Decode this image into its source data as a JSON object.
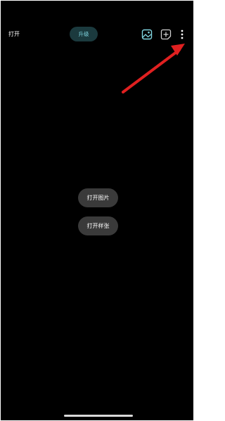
{
  "header": {
    "open_label": "打开",
    "upgrade_label": "升级",
    "icons": [
      "gallery-icon",
      "add-icon",
      "more-vertical-icon"
    ]
  },
  "main": {
    "open_image_label": "打开图片",
    "open_sample_label": "打开样张"
  },
  "colors": {
    "background": "#000000",
    "accent": "#7fd4df",
    "upgrade_bg": "#1b3a3e",
    "pill_bg": "#3a3a3a",
    "annotation_arrow": "#e02020"
  }
}
